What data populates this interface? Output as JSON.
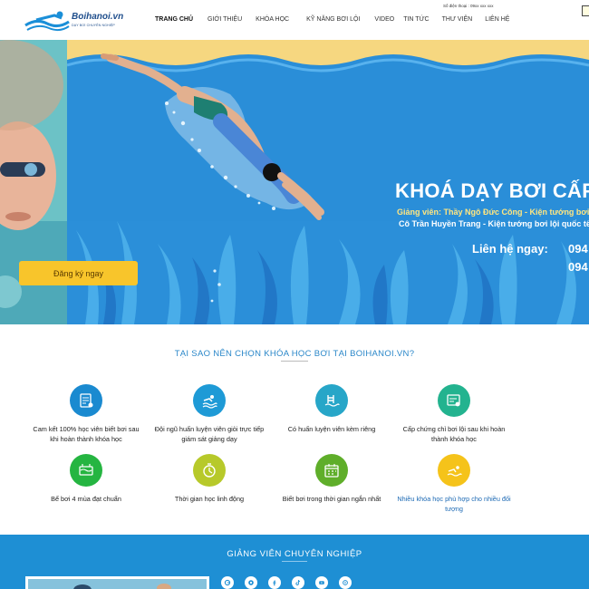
{
  "header": {
    "logo_text": "Boihanoi.vn",
    "logo_sub": "DẠY BƠI CHUYÊN NGHIỆP",
    "phone_text": "Số điện thoại : 09xx xxx xxx",
    "nav": [
      {
        "label": "TRANG CHỦ",
        "active": true
      },
      {
        "label": "GIỚI THIỆU"
      },
      {
        "label": "KHÓA HỌC"
      },
      {
        "label": "KỸ NĂNG BƠI LỘI"
      },
      {
        "label": "VIDEO"
      },
      {
        "label": "TIN TỨC"
      },
      {
        "label": "THƯ VIỆN"
      },
      {
        "label": "LIÊN HỆ"
      }
    ]
  },
  "hero": {
    "course_title": "KHOÁ DẠY BƠI CẤP",
    "teacher_line1": "Giảng viên: Thầy Ngô Đức Công - Kiện tướng bơi lộ",
    "teacher_line2": "Cô Trần Huyền Trang - Kiện tướng bơi lội quốc tế",
    "contact_label": "Liên hệ ngay:",
    "phone_1": "094",
    "phone_2": "094",
    "register_button": "Đăng ký ngay"
  },
  "why": {
    "title": "TẠI SAO NÊN CHỌN KHÓA HỌC BƠI TẠI BOIHANOI.VN?",
    "features": [
      {
        "text": "Cam kết 100% học viên biết bơi sau khi hoàn thành khóa học",
        "icon": "certificate-icon",
        "color": "#1a8ad0"
      },
      {
        "text": "Đội ngũ huấn luyện viên giỏi trực tiếp giám sát giảng dạy",
        "icon": "swimmer-icon",
        "color": "#1e9ad6"
      },
      {
        "text": "Có huấn luyện viên kèm riêng",
        "icon": "pool-ladder-icon",
        "color": "#27a6c8"
      },
      {
        "text": "Cấp chứng chỉ bơi lội sau khi hoàn thành khóa học",
        "icon": "diploma-icon",
        "color": "#23b38f"
      },
      {
        "text": "Bể bơi 4 mùa đạt chuẩn",
        "icon": "pool-icon",
        "color": "#25b541"
      },
      {
        "text": "Thời gian học linh động",
        "icon": "stopwatch-icon",
        "color": "#b7c92a"
      },
      {
        "text": "Biết bơi trong thời gian ngắn nhất",
        "icon": "calendar-icon",
        "color": "#5fae2a"
      },
      {
        "text": "Nhiều khóa học phù hợp cho nhiều đối tượng",
        "icon": "swimming-icon",
        "color": "#f5c31a",
        "link": true
      }
    ]
  },
  "instructors": {
    "title": "GIẢNG VIÊN CHUYÊN NGHIỆP",
    "socials": [
      "google-icon",
      "instagram-icon",
      "facebook-icon",
      "tiktok-icon",
      "youtube-icon",
      "mail-icon"
    ]
  }
}
